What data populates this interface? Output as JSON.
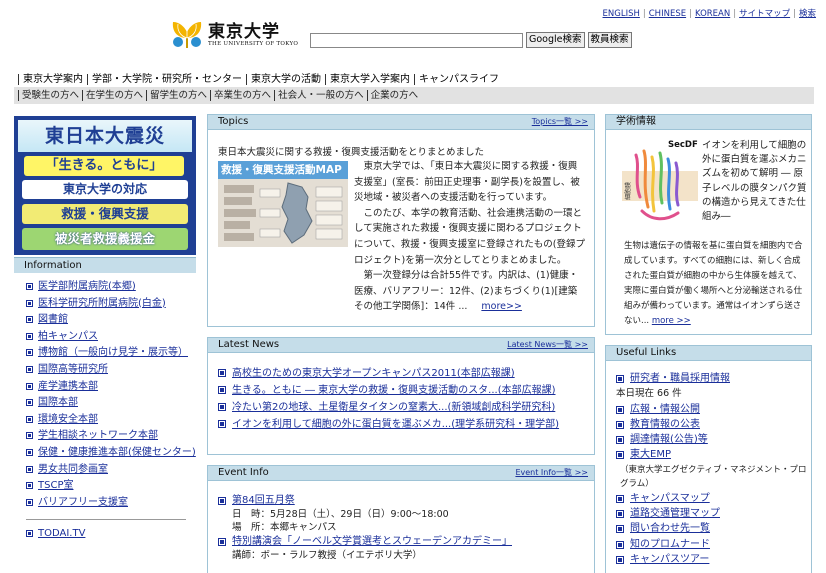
{
  "top_links": [
    "ENGLISH",
    "CHINESE",
    "KOREAN",
    "サイトマップ",
    "検索"
  ],
  "logo": {
    "ja": "東京大学",
    "en": "THE UNIVERSITY OF TOKYO"
  },
  "search": {
    "placeholder": "",
    "google_button": "Google検索",
    "staff_button": "教員検索"
  },
  "nav_primary": [
    "東京大学案内",
    "学部・大学院・研究所・センター",
    "東京大学の活動",
    "東京大学入学案内",
    "キャンパスライフ"
  ],
  "nav_secondary": [
    "受験生の方へ",
    "在学生の方へ",
    "留学生の方へ",
    "卒業生の方へ",
    "社会人・一般の方へ",
    "企業の方へ"
  ],
  "banner": {
    "title": "東日本大震災",
    "slogan": "「生きる。ともに」",
    "line1": "東京大学の対応",
    "line2": "救援・復興支援",
    "line3": "被災者救援義援金"
  },
  "information": {
    "title": "Information",
    "items": [
      "医学部附属病院(本郷)",
      "医科学研究所附属病院(白金)",
      "図書館",
      "柏キャンパス",
      "博物館（一般向け見学・展示等）",
      "国際高等研究所",
      "産学連携本部",
      "国際本部",
      "環境安全本部",
      "学生相談ネットワーク本部",
      "保健・健康推進本部(保健センター)",
      "男女共同参画室",
      "TSCP室",
      "バリアフリー支援室"
    ],
    "extra": [
      "TODAI.TV"
    ]
  },
  "topics": {
    "title": "Topics",
    "more": "Topics一覧 >>",
    "headline": "東日本大震災に関する救援・復興支援活動をとりまとめました",
    "map_label": "救援・復興支援活動MAP",
    "para1": "東京大学では、「東日本大震災に関する救援・復興支援室」(室長：前田正史理事・副学長)を設置し、被災地域・被災者への支援活動を行っています。",
    "para2": "このたび、本学の教育活動、社会連携活動の一環として実施された救援・復興支援に関わるプロジェクトについて、救援・復興支援室に登録されたもの(登録プロジェクト)を第一次分としてとりまとめました。",
    "para3": "第一次登録分は合計55件です。内訳は、(1)健康・医療、バリアフリー：12件、(2)まちづくり(1)[建築その他工学関係]：14件 ...",
    "more_inline": "more>>"
  },
  "latest_news": {
    "title": "Latest News",
    "more": "Latest News一覧 >>",
    "items": [
      "高校生のための東京大学オープンキャンパス2011(本部広報課)",
      "生きる。ともに ― 東京大学の救援・復興支援活動のスタ...(本部広報課)",
      "冷たい第2の地球、土星衛星タイタンの窒素大...(新領域創成科学研究科)",
      "イオンを利用して細胞の外に蛋白質を運ぶメカ...(理学系研究科・理学部)"
    ]
  },
  "event_info": {
    "title": "Event Info",
    "more": "Event Info一覧 >>",
    "events": [
      {
        "name": "第84回五月祭",
        "details": [
          "日　時：5月28日（土）、29日（日）9:00～18:00",
          "場　所：本郷キャンパス"
        ]
      },
      {
        "name": "特別講演会「ノーベル文学賞選考とスウェーデンアカデミー」",
        "details": [
          "講師：ボー・ラルフ教授（イエテボリ大学）"
        ]
      }
    ]
  },
  "research": {
    "title": "学術情報",
    "figure_label": "SecDF",
    "figure_side": "細胞膜",
    "summary": "イオンを利用して細胞の外に蛋白質を運ぶメカニズムを初めて解明 ― 原子レベルの膜タンパク質の構造から見えてきた仕組み―",
    "body": "生物は遺伝子の情報を基に蛋白質を細胞内で合成しています。すべての細胞には、新しく合成された蛋白質が細胞の中から生体膜を越えて、実際に蛋白質が働く場所へと分泌輸送される仕組みが備わっています。通常はイオンずら送さない...",
    "more": "more >>"
  },
  "useful_links": {
    "title": "Useful Links",
    "items": [
      {
        "type": "link",
        "text": "研究者・職員採用情報"
      },
      {
        "type": "sub",
        "text": "本日現在 66 件"
      },
      {
        "type": "link",
        "text": "広報・情報公開"
      },
      {
        "type": "link",
        "text": "教育情報の公表"
      },
      {
        "type": "link",
        "text": "調達情報(公告)等"
      },
      {
        "type": "link",
        "text": "東大EMP"
      },
      {
        "type": "sub2",
        "text": "（東京大学エグゼクティブ・マネジメント・プログラム）"
      },
      {
        "type": "link",
        "text": "キャンパスマップ"
      },
      {
        "type": "link",
        "text": "道路交通管理マップ"
      },
      {
        "type": "link",
        "text": "問い合わせ先一覧"
      },
      {
        "type": "link",
        "text": "知のプロムナード"
      },
      {
        "type": "link",
        "text": "キャンパスツアー"
      }
    ]
  },
  "colors": {
    "link": "#1a2f9a",
    "panel_header": "#c5dde9",
    "banner": "#1f3f94"
  }
}
